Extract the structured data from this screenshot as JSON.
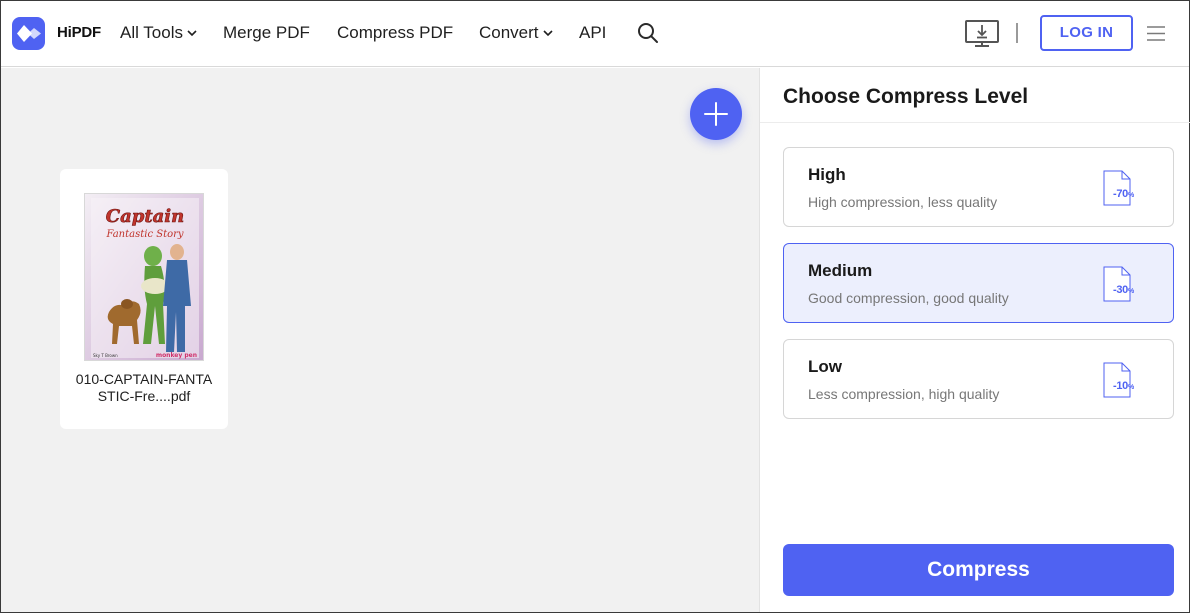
{
  "brand": {
    "name": "HiPDF",
    "accent_color": "#4f62f2",
    "logo_icon": "hipdf-logo-icon"
  },
  "nav": {
    "items": [
      {
        "label": "All Tools",
        "has_dropdown": true
      },
      {
        "label": "Merge PDF",
        "has_dropdown": false
      },
      {
        "label": "Compress PDF",
        "has_dropdown": false
      },
      {
        "label": "Convert",
        "has_dropdown": true
      },
      {
        "label": "API",
        "has_dropdown": false
      }
    ],
    "search_icon": "search-icon",
    "desktop_icon": "desktop-download-icon",
    "login_label": "LOG IN",
    "menu_icon": "hamburger-menu-icon"
  },
  "workspace": {
    "add_icon": "plus-icon",
    "file": {
      "name": "010-CAPTAIN-FANTASTIC-Fre....pdf",
      "thumbnail": {
        "title": "Captain",
        "subtitle": "Fantastic Story",
        "author": "Sky T Brown",
        "publisher": "monkey pen"
      }
    }
  },
  "panel": {
    "title": "Choose Compress Level",
    "levels": [
      {
        "name": "High",
        "description": "High compression, less quality",
        "percent": "-70",
        "unit": "%",
        "selected": false
      },
      {
        "name": "Medium",
        "description": "Good compression, good quality",
        "percent": "-30",
        "unit": "%",
        "selected": true
      },
      {
        "name": "Low",
        "description": "Less compression, high quality",
        "percent": "-10",
        "unit": "%",
        "selected": false
      }
    ],
    "action_label": "Compress"
  }
}
